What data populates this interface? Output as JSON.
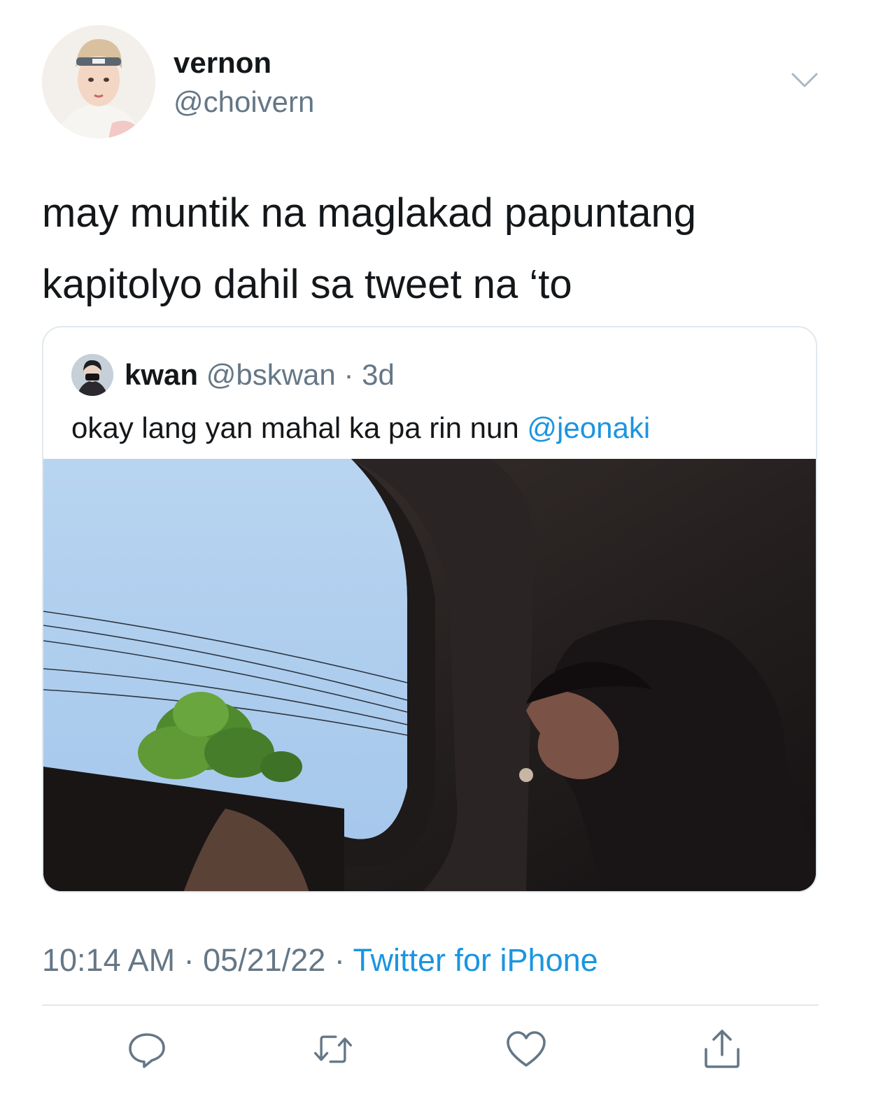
{
  "tweet": {
    "author": {
      "display_name": "vernon",
      "handle": "@choivern",
      "avatar_icon": "avatar-photo"
    },
    "text": "may muntik na maglakad papuntang kapitolyo dahil sa tweet na ‘to",
    "quoted": {
      "display_name": "kwan",
      "handle": "@bskwan",
      "separator": "·",
      "age": "3d",
      "text": "okay lang yan mahal ka pa rin nun ",
      "mention": "@jeonaki",
      "media_icon": "car-window-photo"
    },
    "meta": {
      "time": "10:14 AM",
      "separator": " · ",
      "date": "05/21/22",
      "source": "Twitter for iPhone"
    },
    "actions": [
      {
        "name": "reply",
        "icon": "reply-icon"
      },
      {
        "name": "retweet",
        "icon": "retweet-icon"
      },
      {
        "name": "like",
        "icon": "heart-icon"
      },
      {
        "name": "share",
        "icon": "share-icon"
      }
    ]
  },
  "colors": {
    "text": "#14171a",
    "secondary": "#657786",
    "link": "#1b95e0",
    "border": "#e1e8ed"
  }
}
